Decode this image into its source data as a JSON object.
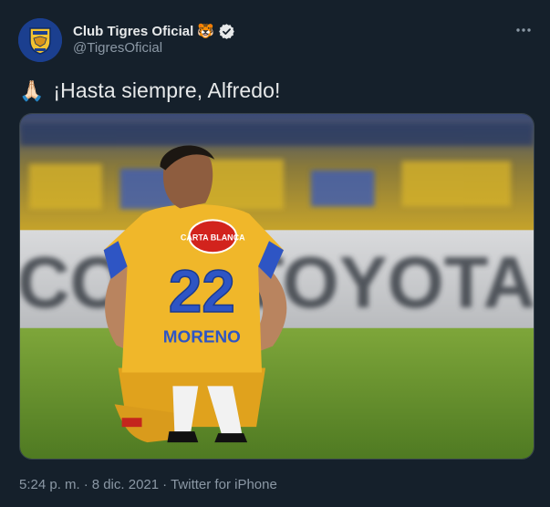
{
  "tweet": {
    "display_name": "Club Tigres Oficial",
    "name_emoji": "🐯",
    "handle": "@TigresOficial",
    "verified": true,
    "text_emoji": "🙏🏻",
    "text": "¡Hasta siempre, Alfredo!",
    "media": {
      "sponsor_banner": "COPA TOYOTA",
      "jersey_sponsor": "CARTA BLANCA",
      "jersey_number": "22",
      "jersey_name": "MORENO"
    },
    "time": "5:24 p. m.",
    "date": "8 dic. 2021",
    "separator": "·",
    "source": "Twitter for iPhone"
  },
  "icons": {
    "verified": "verified-badge-icon",
    "more": "more-horizontal-icon"
  },
  "colors": {
    "background": "#15202b",
    "text": "#e7e9ea",
    "secondary": "#8b98a5",
    "jersey_gold": "#f3b925",
    "jersey_blue": "#2e55c4",
    "pitch": "#5e8b2a"
  }
}
